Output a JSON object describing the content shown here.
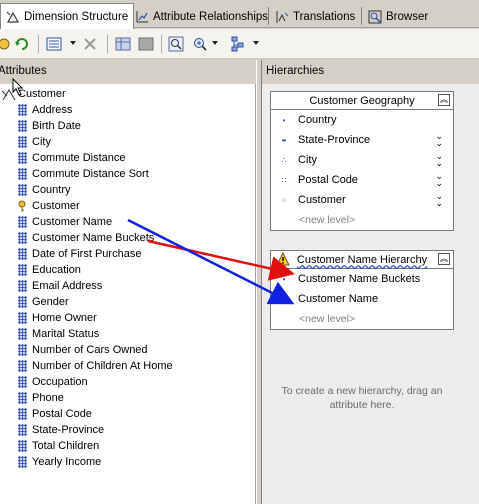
{
  "tabs": [
    {
      "label": "Dimension Structure",
      "icon": "dimension-structure-icon",
      "active": true
    },
    {
      "label": "Attribute Relationships",
      "icon": "attribute-relationships-icon",
      "active": false
    },
    {
      "label": "Translations",
      "icon": "translations-icon",
      "active": false
    },
    {
      "label": "Browser",
      "icon": "browser-icon",
      "active": false
    }
  ],
  "toolbar": {
    "buttons": [
      "process-icon",
      "refresh-icon",
      "new-hierarchy-icon",
      "delete-icon",
      "show-table-icon",
      "hide-table-icon",
      "zoom-icon",
      "zoom-options-icon",
      "layout-icon"
    ]
  },
  "attributes": {
    "header": "Attributes",
    "root": "Customer",
    "items": [
      "Address",
      "Birth Date",
      "City",
      "Commute Distance",
      "Commute Distance Sort",
      "Country",
      "Customer",
      "Customer Name",
      "Customer Name Buckets",
      "Date of First Purchase",
      "Education",
      "Email Address",
      "Gender",
      "Home Owner",
      "Marital Status",
      "Number of Cars Owned",
      "Number of Children At Home",
      "Occupation",
      "Phone",
      "Postal Code",
      "State-Province",
      "Total Children",
      "Yearly Income"
    ]
  },
  "hierarchies": {
    "header": "Hierarchies",
    "geography": {
      "title": "Customer Geography",
      "levels": [
        "Country",
        "State-Province",
        "City",
        "Postal Code",
        "Customer"
      ],
      "new_level": "<new level>"
    },
    "name_hierarchy": {
      "title": "Customer Name Hierarchy",
      "levels": [
        "Customer Name Buckets",
        "Customer Name"
      ],
      "new_level": "<new level>"
    },
    "hint": "To create a new hierarchy, drag an attribute here."
  },
  "colors": {
    "arrow_red": "#e01010",
    "arrow_blue": "#1020e0",
    "attribute_icon": "#2d4fa8"
  }
}
